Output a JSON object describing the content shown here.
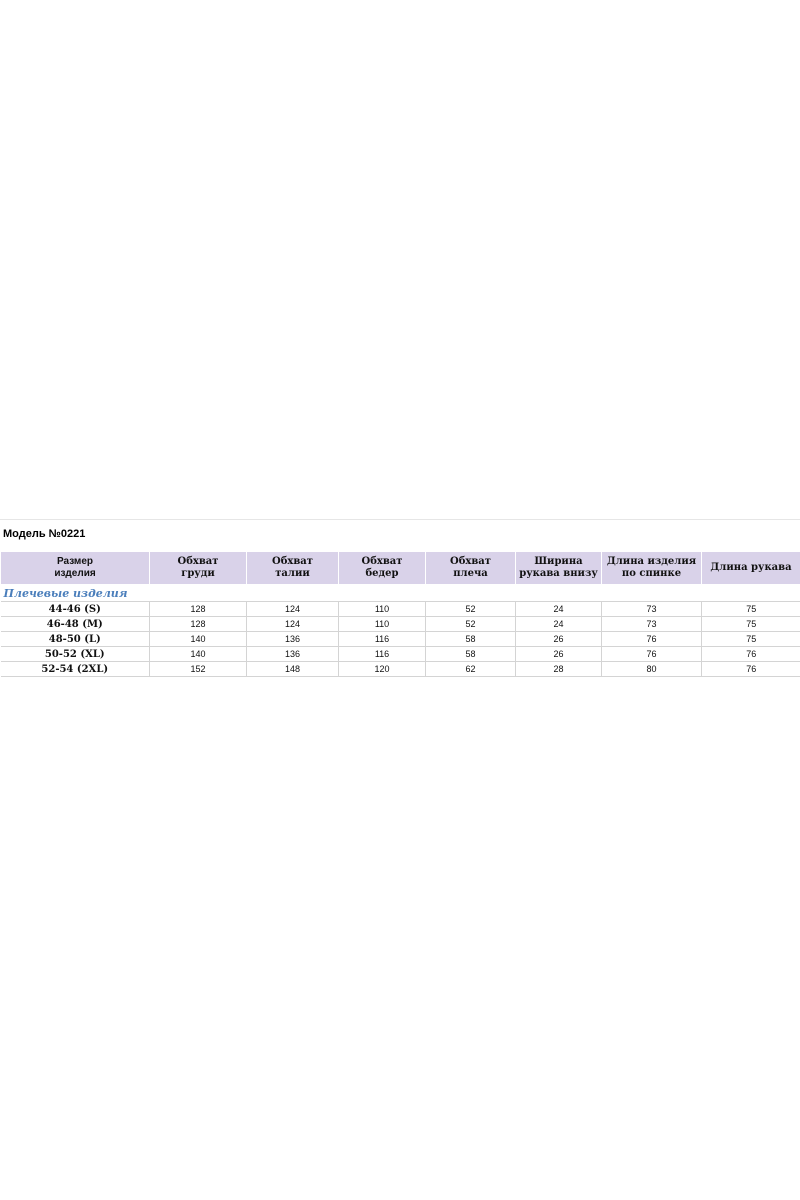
{
  "model_title": "Модель №0221",
  "columns": [
    [
      "Размер",
      "изделия"
    ],
    [
      "Обхват",
      "груди"
    ],
    [
      "Обхват",
      "талии"
    ],
    [
      "Обхват",
      "бедер"
    ],
    [
      "Обхват",
      "плеча"
    ],
    [
      "Ширина",
      "рукава внизу"
    ],
    [
      "Длина изделия",
      "по спинке"
    ],
    [
      "Длина рукава",
      ""
    ]
  ],
  "section_label": "Плечевые изделия",
  "rows": [
    [
      "44-46 (S)",
      "128",
      "124",
      "110",
      "52",
      "24",
      "73",
      "75"
    ],
    [
      "46-48 (M)",
      "128",
      "124",
      "110",
      "52",
      "24",
      "73",
      "75"
    ],
    [
      "48-50 (L)",
      "140",
      "136",
      "116",
      "58",
      "26",
      "76",
      "75"
    ],
    [
      "50-52 (XL)",
      "140",
      "136",
      "116",
      "58",
      "26",
      "76",
      "76"
    ],
    [
      "52-54 (2XL)",
      "152",
      "148",
      "120",
      "62",
      "28",
      "80",
      "76"
    ]
  ],
  "colors": {
    "header_bg": "#d9d2e9",
    "section_text": "#4a7ebb",
    "grid_line": "#d4d4d4"
  }
}
